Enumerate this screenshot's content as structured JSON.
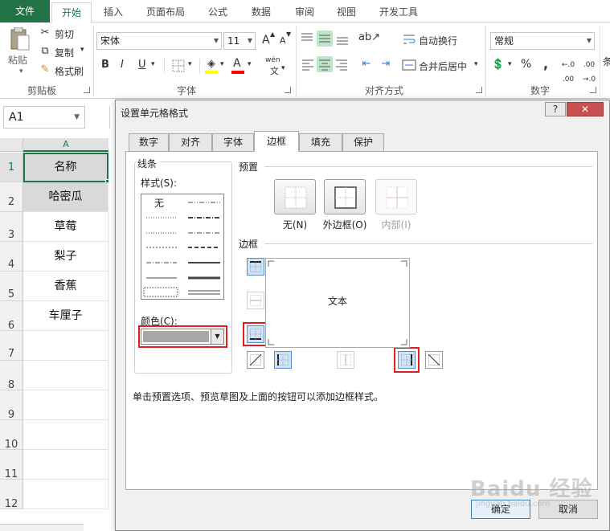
{
  "ribbon_tabs": [
    "文件",
    "开始",
    "插入",
    "页面布局",
    "公式",
    "数据",
    "审阅",
    "视图",
    "开发工具"
  ],
  "clipboard": {
    "paste": "粘贴",
    "cut": "剪切",
    "copy": "复制",
    "format_painter": "格式刷",
    "group": "剪贴板"
  },
  "font": {
    "name": "宋体",
    "size": "11",
    "bold": "B",
    "italic": "I",
    "underline": "U",
    "grow": "A",
    "shrink": "A",
    "font_color": "A",
    "phonetic": "wén",
    "group": "字体"
  },
  "alignment": {
    "wrap": "自动换行",
    "merge": "合并后居中",
    "group": "对齐方式"
  },
  "number": {
    "format": "常规",
    "percent": "%",
    "comma": ",",
    "group": "数字",
    "cut_off": "条"
  },
  "sheet": {
    "namebox": "A1",
    "column": "A",
    "rows": [
      "1",
      "2",
      "3",
      "4",
      "5",
      "6",
      "7",
      "8",
      "9",
      "10",
      "11",
      "12"
    ],
    "cells": [
      "名称",
      "哈密瓜",
      "草莓",
      "梨子",
      "香蕉",
      "车厘子"
    ]
  },
  "dialog": {
    "title": "设置单元格格式",
    "help": "?",
    "close": "✕",
    "tabs": [
      "数字",
      "对齐",
      "字体",
      "边框",
      "填充",
      "保护"
    ],
    "active_tab": "边框",
    "line_group": "线条",
    "style_label": "样式(S):",
    "none_style": "无",
    "color_label": "颜色(C):",
    "preset_group": "预置",
    "presets": [
      "无(N)",
      "外边框(O)",
      "内部(I)"
    ],
    "border_group": "边框",
    "preview_text": "文本",
    "hint": "单击预置选项、预览草图及上面的按钮可以添加边框样式。",
    "ok": "确定",
    "cancel": "取消"
  },
  "colors": {
    "excel_green": "#217346",
    "highlight_red": "#e02020",
    "selected_button": "#cfe3f7"
  },
  "watermark": {
    "main": "Baidu 经验",
    "sub": "jingyan.baidu.com"
  }
}
